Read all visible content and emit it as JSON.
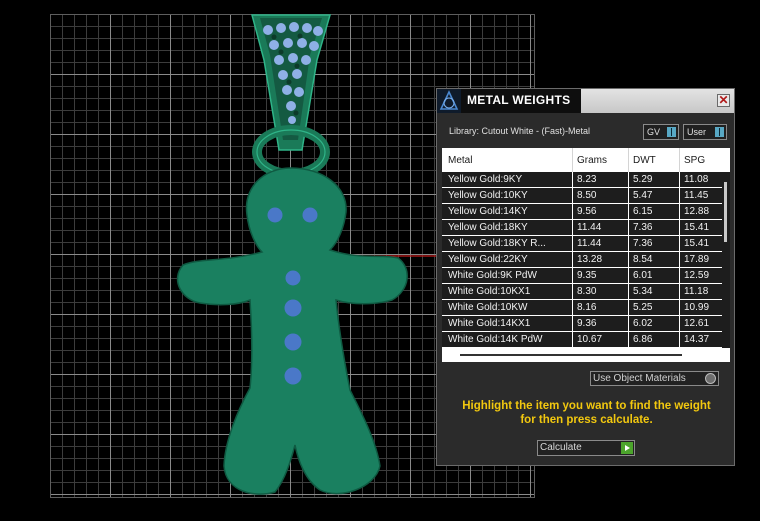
{
  "dialog": {
    "title": "METAL WEIGHTS",
    "library_label": "Library: Cutout White - (Fast)-Metal",
    "gv_select": "GV",
    "user_select": "User",
    "headers": [
      "Metal",
      "Grams",
      "DWT",
      "SPG"
    ],
    "rows": [
      {
        "metal": "Yellow Gold:9KY",
        "grams": "8.23",
        "dwt": "5.29",
        "spg": "11.08"
      },
      {
        "metal": "Yellow Gold:10KY",
        "grams": "8.50",
        "dwt": "5.47",
        "spg": "11.45"
      },
      {
        "metal": "Yellow Gold:14KY",
        "grams": "9.56",
        "dwt": "6.15",
        "spg": "12.88"
      },
      {
        "metal": "Yellow Gold:18KY",
        "grams": "11.44",
        "dwt": "7.36",
        "spg": "15.41"
      },
      {
        "metal": "Yellow Gold:18KY R...",
        "grams": "11.44",
        "dwt": "7.36",
        "spg": "15.41"
      },
      {
        "metal": "Yellow Gold:22KY",
        "grams": "13.28",
        "dwt": "8.54",
        "spg": "17.89"
      },
      {
        "metal": "White Gold:9K PdW",
        "grams": "9.35",
        "dwt": "6.01",
        "spg": "12.59"
      },
      {
        "metal": "White Gold:10KX1",
        "grams": "8.30",
        "dwt": "5.34",
        "spg": "11.18"
      },
      {
        "metal": "White Gold:10KW",
        "grams": "8.16",
        "dwt": "5.25",
        "spg": "10.99"
      },
      {
        "metal": "White Gold:14KX1",
        "grams": "9.36",
        "dwt": "6.02",
        "spg": "12.61"
      },
      {
        "metal": "White Gold:14K PdW",
        "grams": "10.67",
        "dwt": "6.86",
        "spg": "14.37"
      }
    ],
    "use_object_materials": "Use Object Materials",
    "instruction_line1": "Highlight the item you want to find the weight",
    "instruction_line2": "for then press calculate.",
    "calculate_label": "Calculate",
    "close_glyph": "✕"
  },
  "colors": {
    "model_green": "#1a8060",
    "button_blue": "#4a78c8",
    "instruction_yellow": "#f2c80f"
  }
}
